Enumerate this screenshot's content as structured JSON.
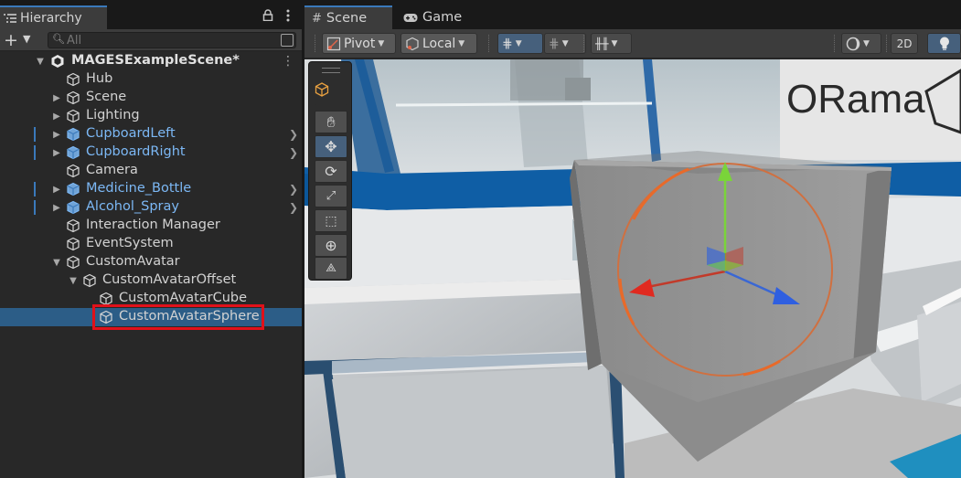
{
  "hierarchy": {
    "tab_label": "Hierarchy",
    "lock_icon": "lock-icon",
    "menu_icon": "kebab-icon",
    "add_label": "+",
    "search_placeholder": "All",
    "scene_name": "MAGESExampleScene*",
    "items": [
      {
        "label": "Hub",
        "depth": 1,
        "prefab": false,
        "foldout": false
      },
      {
        "label": "Scene",
        "depth": 1,
        "prefab": false,
        "foldout": true
      },
      {
        "label": "Lighting",
        "depth": 1,
        "prefab": false,
        "foldout": true
      },
      {
        "label": "CupboardLeft",
        "depth": 1,
        "prefab": true,
        "foldout": true
      },
      {
        "label": "CupboardRight",
        "depth": 1,
        "prefab": true,
        "foldout": true
      },
      {
        "label": "Camera",
        "depth": 1,
        "prefab": false,
        "foldout": false
      },
      {
        "label": "Medicine_Bottle",
        "depth": 1,
        "prefab": true,
        "foldout": true
      },
      {
        "label": "Alcohol_Spray",
        "depth": 1,
        "prefab": true,
        "foldout": true
      },
      {
        "label": "Interaction Manager",
        "depth": 1,
        "prefab": false,
        "foldout": false
      },
      {
        "label": "EventSystem",
        "depth": 1,
        "prefab": false,
        "foldout": false
      },
      {
        "label": "CustomAvatar",
        "depth": 1,
        "prefab": false,
        "foldout": true
      },
      {
        "label": "CustomAvatarOffset",
        "depth": 2,
        "prefab": false,
        "foldout": true
      },
      {
        "label": "CustomAvatarCube",
        "depth": 3,
        "prefab": false,
        "foldout": false
      },
      {
        "label": "CustomAvatarSphere",
        "depth": 3,
        "prefab": false,
        "foldout": false,
        "selected": true
      }
    ]
  },
  "scene_view": {
    "tabs": [
      {
        "label": "Scene",
        "icon": "grid-icon",
        "active": true
      },
      {
        "label": "Game",
        "icon": "gamepad-icon",
        "active": false
      }
    ],
    "toolbar": {
      "pivot_label": "Pivot",
      "local_label": "Local",
      "mode_2d_label": "2D"
    },
    "wall_logo_text": "ORama",
    "accent_color": "#3a79bb",
    "selection_color": "#2c5d87",
    "highlight_color": "#e0111a"
  }
}
